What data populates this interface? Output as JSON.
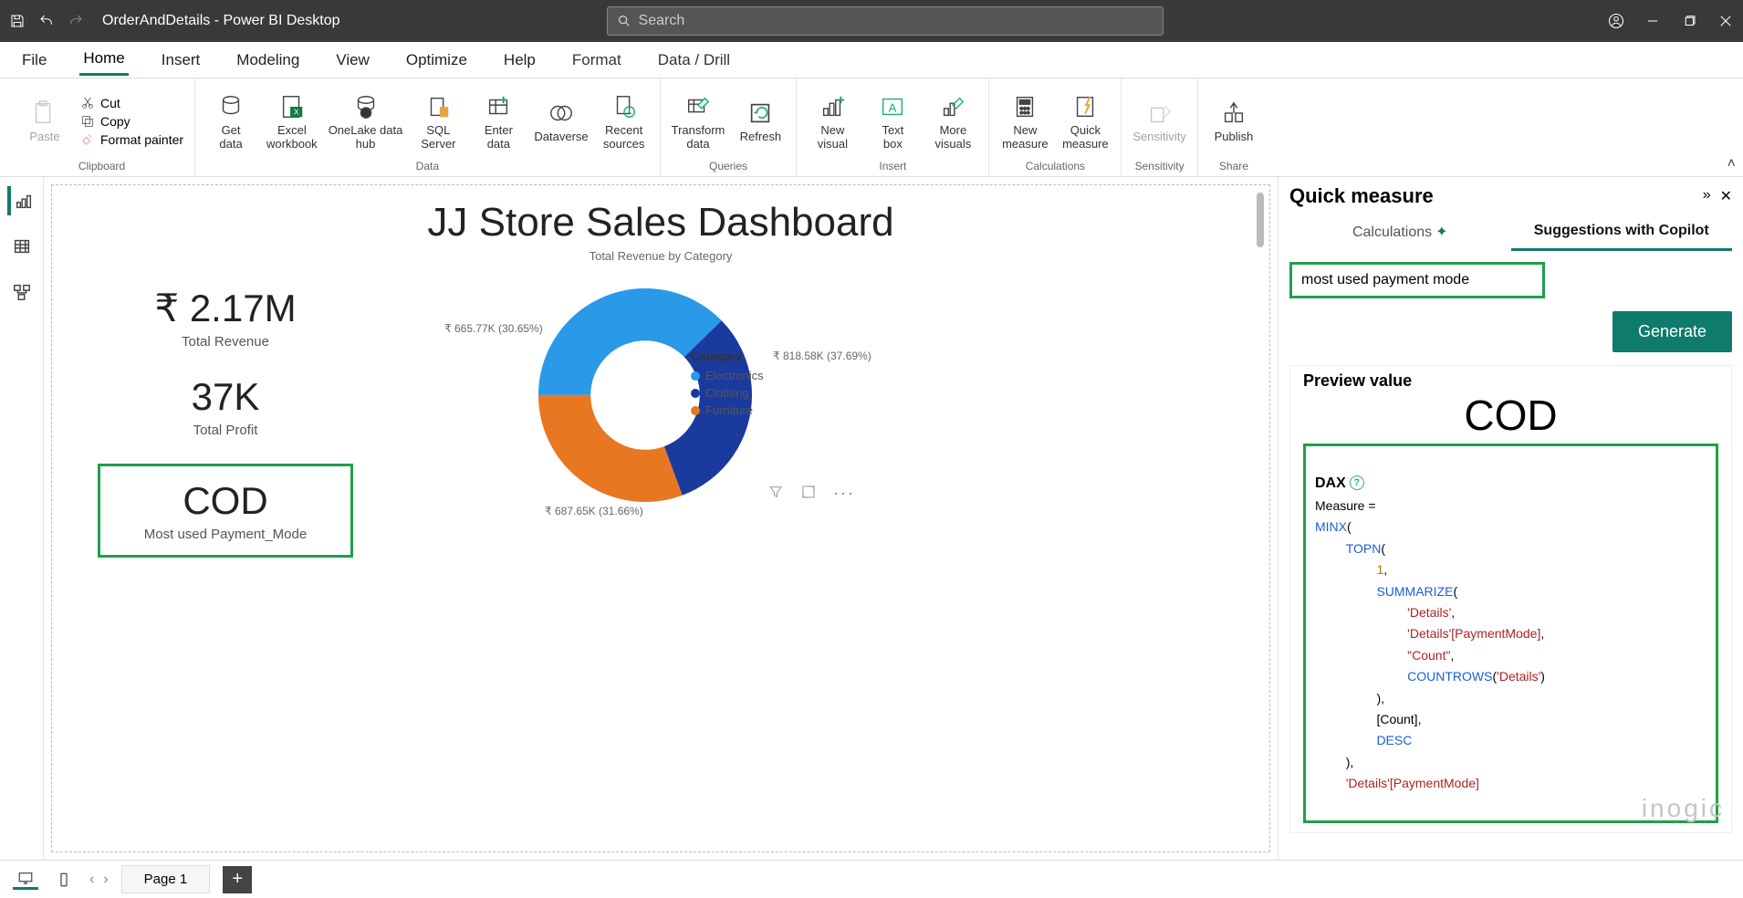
{
  "titlebar": {
    "document": "OrderAndDetails - Power BI Desktop",
    "search_placeholder": "Search"
  },
  "menu": {
    "file": "File",
    "home": "Home",
    "insert": "Insert",
    "modeling": "Modeling",
    "view": "View",
    "optimize": "Optimize",
    "help": "Help",
    "format": "Format",
    "data_drill": "Data / Drill"
  },
  "ribbon": {
    "paste": {
      "label": "Paste",
      "cut": "Cut",
      "copy": "Copy",
      "format_painter": "Format painter",
      "group": "Clipboard"
    },
    "data": {
      "get_data": "Get\ndata",
      "excel": "Excel\nworkbook",
      "onelake": "OneLake data\nhub",
      "sql": "SQL\nServer",
      "enter": "Enter\ndata",
      "dataverse": "Dataverse",
      "recent": "Recent\nsources",
      "group": "Data"
    },
    "queries": {
      "transform": "Transform\ndata",
      "refresh": "Refresh",
      "group": "Queries"
    },
    "insert": {
      "new_visual": "New\nvisual",
      "text_box": "Text\nbox",
      "more": "More\nvisuals",
      "group": "Insert"
    },
    "calc": {
      "new_measure": "New\nmeasure",
      "quick_measure": "Quick\nmeasure",
      "group": "Calculations"
    },
    "sensitivity": {
      "label": "Sensitivity",
      "group": "Sensitivity"
    },
    "share": {
      "publish": "Publish",
      "group": "Share"
    }
  },
  "dashboard": {
    "title": "JJ Store Sales Dashboard",
    "subtitle": "Total Revenue by Category",
    "kpi_revenue_value": "₹ 2.17M",
    "kpi_revenue_label": "Total Revenue",
    "kpi_profit_value": "37K",
    "kpi_profit_label": "Total Profit",
    "kpi_cod_value": "COD",
    "kpi_cod_label": "Most used Payment_Mode"
  },
  "chart_data": {
    "type": "pie",
    "title": "Total Revenue by Category",
    "legend_title": "Category",
    "slices": [
      {
        "category": "Electronics",
        "value": 818580,
        "pct": 37.69,
        "label": "₹ 818.58K (37.69%)",
        "color": "#2a99e8"
      },
      {
        "category": "Clothing",
        "value": 687650,
        "pct": 31.66,
        "label": "₹ 687.65K (31.66%)",
        "color": "#1b3a9e"
      },
      {
        "category": "Furniture",
        "value": 665770,
        "pct": 30.65,
        "label": "₹ 665.77K (30.65%)",
        "color": "#e87722"
      }
    ]
  },
  "quick_measure": {
    "title": "Quick measure",
    "tab_calculations": "Calculations",
    "tab_copilot": "Suggestions with Copilot",
    "input_value": "most used payment mode",
    "generate": "Generate",
    "preview_title": "Preview value",
    "preview_value": "COD",
    "dax_heading": "DAX",
    "dax": {
      "l1": "Measure =",
      "l2": "MINX",
      "l2b": "(",
      "l3": "TOPN",
      "l3b": "(",
      "l4": "1",
      "l4b": ",",
      "l5": "SUMMARIZE",
      "l5b": "(",
      "l6": "'Details'",
      "l6b": ",",
      "l7": "'Details'[PaymentMode]",
      "l7b": ",",
      "l8": "\"Count\"",
      "l8b": ",",
      "l9": "COUNTROWS",
      "l9b": "(",
      "l9c": "'Details'",
      "l9d": ")",
      "l10": "),",
      "l11": "[Count],",
      "l12": "DESC",
      "l13": "),",
      "l14": "'Details'[PaymentMode]"
    }
  },
  "footer": {
    "page1": "Page 1"
  },
  "watermark": "inogic"
}
